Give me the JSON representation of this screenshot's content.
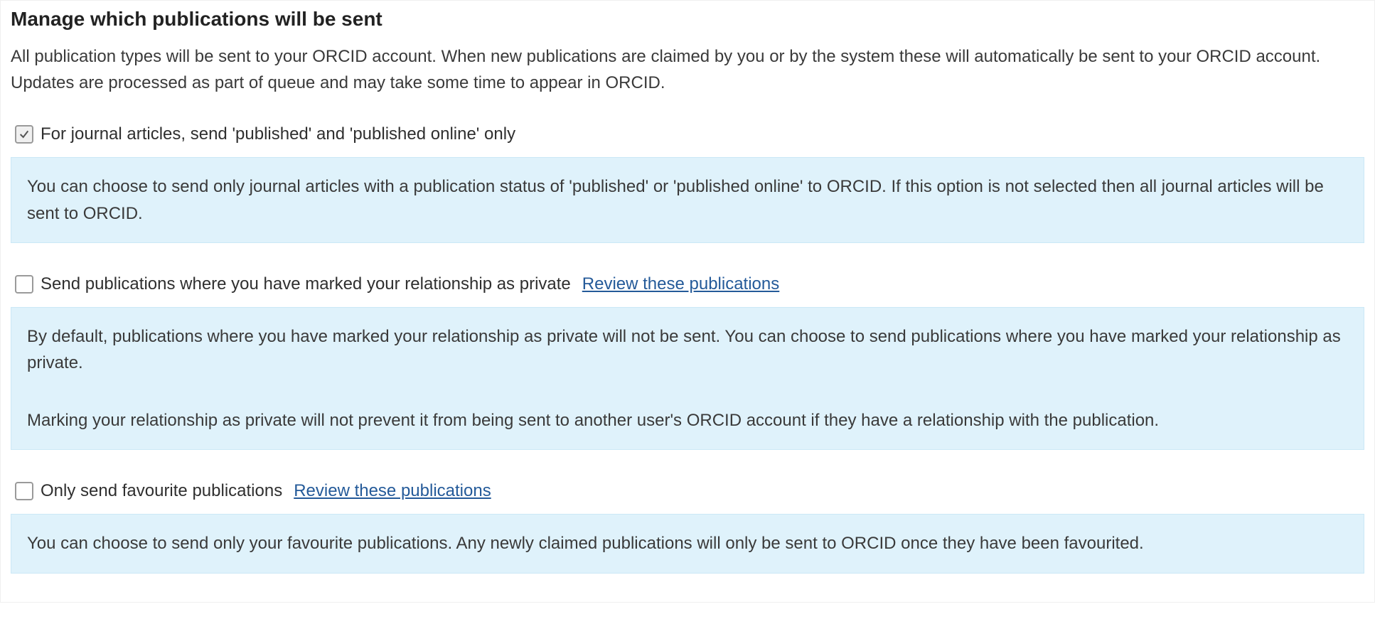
{
  "header": {
    "title": "Manage which publications will be sent",
    "description": "All publication types will be sent to your ORCID account. When new publications are claimed by you or by the system these will automatically be sent to your ORCID account. Updates are processed as part of queue and may take some time to appear in ORCID."
  },
  "options": {
    "journal_articles": {
      "checked": true,
      "label": "For journal articles, send 'published' and 'published online' only",
      "info": "You can choose to send only journal articles with a publication status of 'published' or 'published online' to ORCID. If this option is not selected then all journal articles will be sent to ORCID."
    },
    "private_relationship": {
      "checked": false,
      "label": "Send publications where you have marked your relationship as private",
      "link": "Review these publications",
      "info1": "By default, publications where you have marked your relationship as private will not be sent. You can choose to send publications where you have marked your relationship as private.",
      "info2": "Marking your relationship as private will not prevent it from being sent to another user's ORCID account if they have a relationship with the publication."
    },
    "favourite": {
      "checked": false,
      "label": "Only send favourite publications",
      "link": "Review these publications",
      "info": "You can choose to send only your favourite publications. Any newly claimed publications will only be sent to ORCID once they have been favourited."
    }
  }
}
